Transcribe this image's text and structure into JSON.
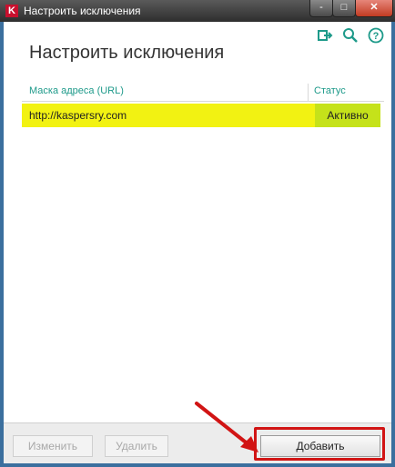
{
  "window": {
    "title": "Настроить исключения",
    "app_icon_letter": "K",
    "app_icon_color": "#c8102e",
    "controls": {
      "minimize": "-",
      "maximize": "□",
      "close": "✕"
    }
  },
  "toolbar_icons": [
    "exit-icon",
    "search-icon",
    "help-icon"
  ],
  "page_title": "Настроить исключения",
  "table": {
    "columns": [
      "Маска адреса (URL)",
      "Статус"
    ],
    "rows": [
      {
        "url": "http://kaspersry.com",
        "status": "Активно"
      }
    ],
    "header_color": "#1e9a8a",
    "row_highlight_color": "#f2f212",
    "status_highlight_color": "#c5e21a"
  },
  "footer": {
    "edit_label": "Изменить",
    "delete_label": "Удалить",
    "add_label": "Добавить"
  },
  "annotation_color": "#d11414"
}
